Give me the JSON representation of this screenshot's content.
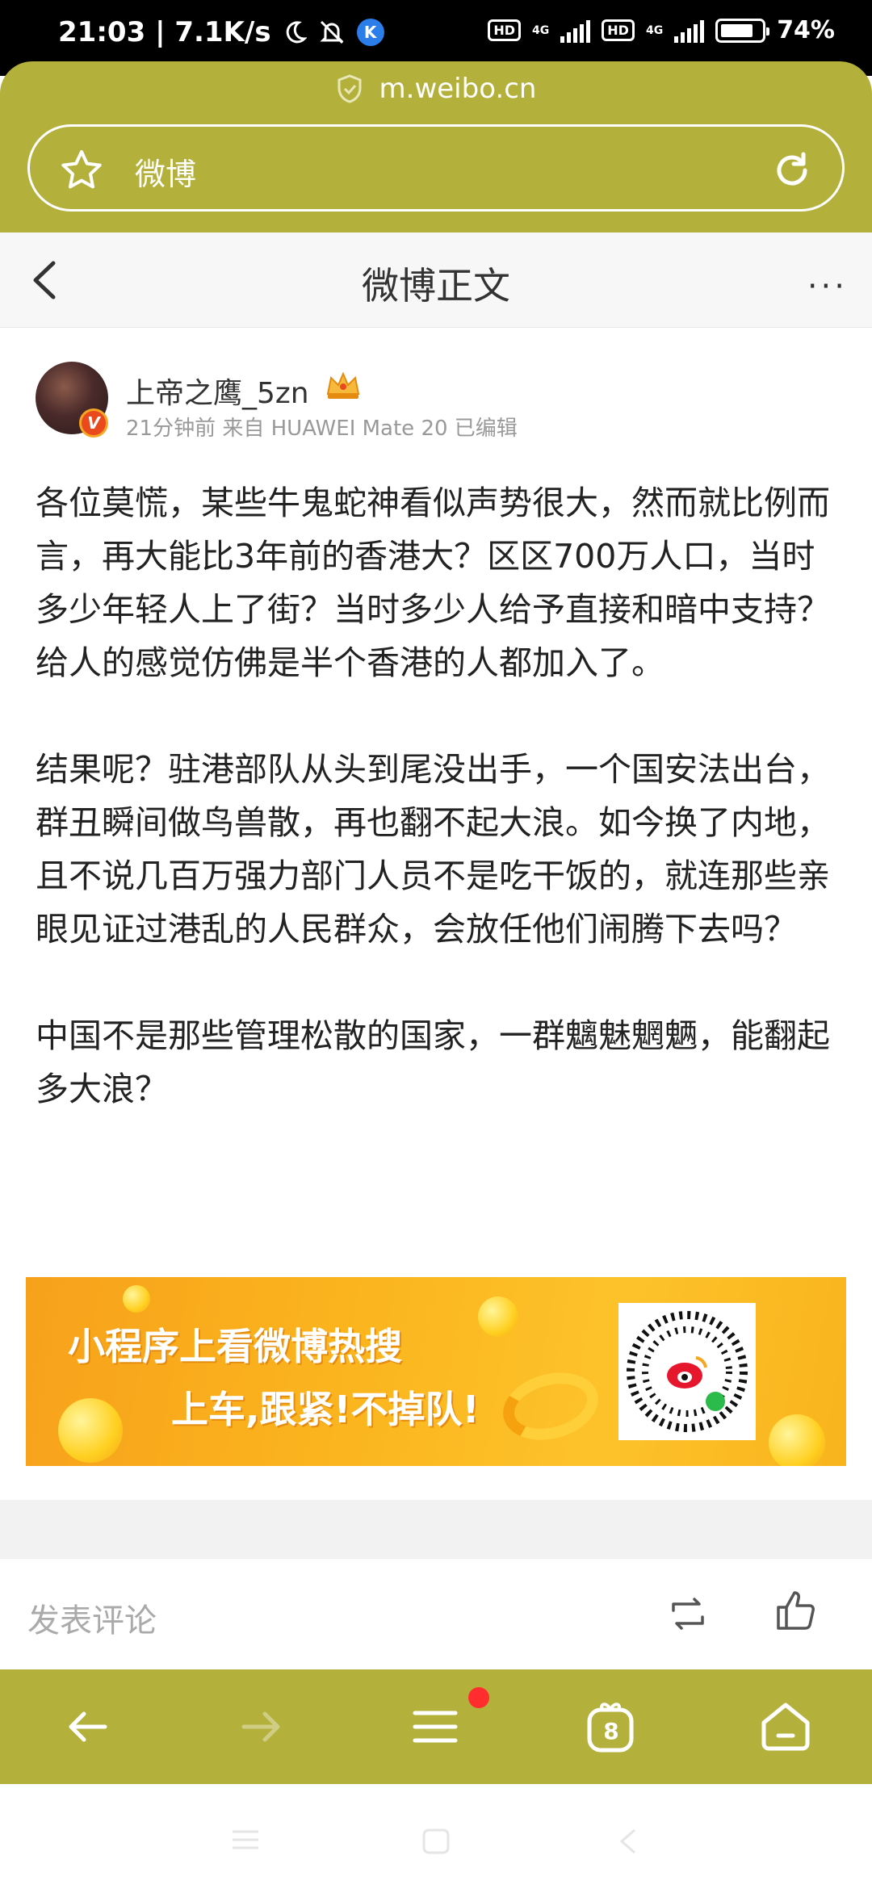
{
  "status_bar": {
    "time_speed": "21:03 | 7.1K/s",
    "k_badge": "K",
    "hd1": "HD",
    "net1": "4G",
    "hd2": "HD",
    "net2": "4G",
    "battery": "74%"
  },
  "browser": {
    "domain": "m.weibo.cn",
    "address_title": "微博"
  },
  "header": {
    "title": "微博正文",
    "more": "···"
  },
  "post": {
    "author_name": "上帝之鹰_5zn",
    "verified_mark": "V",
    "meta": "21分钟前 来自 HUAWEI Mate 20 已编辑",
    "paragraphs": [
      "各位莫慌，某些牛鬼蛇神看似声势很大，然而就比例而言，再大能比3年前的香港大？区区700万人口，当时多少年轻人上了街？当时多少人给予直接和暗中支持？给人的感觉仿佛是半个香港的人都加入了。",
      "结果呢？驻港部队从头到尾没出手，一个国安法出台，群丑瞬间做鸟兽散，再也翻不起大浪。如今换了内地，且不说几百万强力部门人员不是吃干饭的，就连那些亲眼见证过港乱的人民群众，会放任他们闹腾下去吗？",
      "中国不是那些管理松散的国家，一群魑魅魍魉，能翻起多大浪？"
    ]
  },
  "ad": {
    "line1": "小程序上看微博热搜",
    "line2": "上车,跟紧!不掉队!"
  },
  "comment_bar": {
    "placeholder": "发表评论"
  },
  "bottom_nav": {
    "tabs_count": "8"
  },
  "colors": {
    "browser_theme": "#b3b03b",
    "ad_orange": "#f9b41d",
    "notification_dot": "#ff2d2d"
  }
}
